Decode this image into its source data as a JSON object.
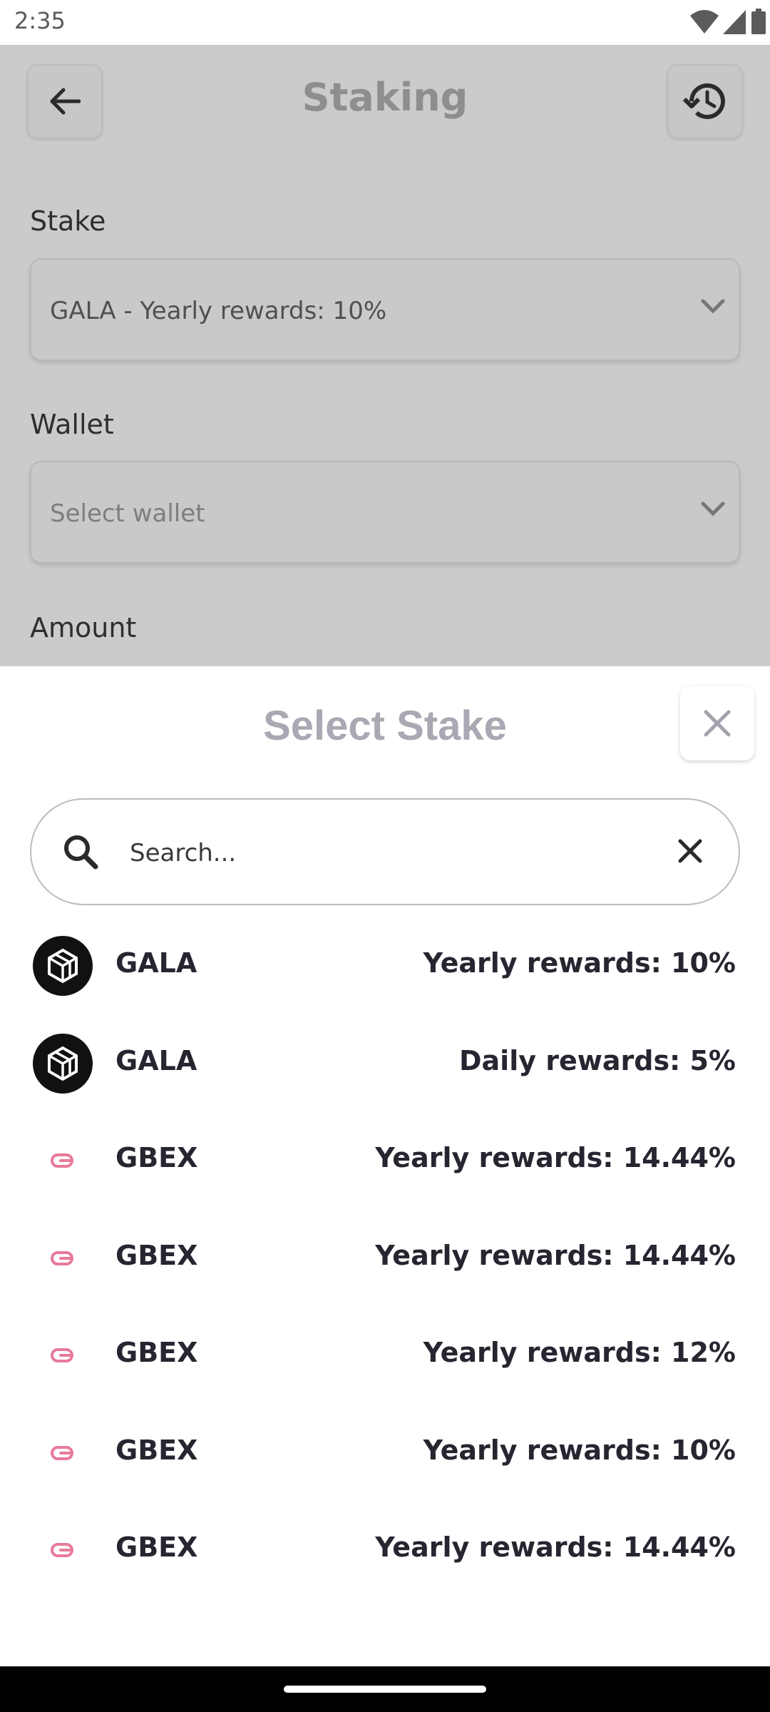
{
  "status_bar": {
    "time": "2:35"
  },
  "header": {
    "title": "Staking"
  },
  "form": {
    "stake_label": "Stake",
    "stake_value": "GALA - Yearly rewards: 10%",
    "wallet_label": "Wallet",
    "wallet_placeholder": "Select wallet",
    "amount_label": "Amount"
  },
  "sheet": {
    "title": "Select Stake",
    "search_placeholder": "Search...",
    "items": [
      {
        "name": "GALA",
        "reward": "Yearly rewards: 10%",
        "icon": "gala-logo-icon"
      },
      {
        "name": "GALA",
        "reward": "Daily rewards: 5%",
        "icon": "gala-logo-icon"
      },
      {
        "name": "GBEX",
        "reward": "Yearly rewards: 14.44%",
        "icon": "gbex-logo-icon"
      },
      {
        "name": "GBEX",
        "reward": "Yearly rewards: 14.44%",
        "icon": "gbex-logo-icon"
      },
      {
        "name": "GBEX",
        "reward": "Yearly rewards: 12%",
        "icon": "gbex-logo-icon"
      },
      {
        "name": "GBEX",
        "reward": "Yearly rewards: 10%",
        "icon": "gbex-logo-icon"
      },
      {
        "name": "GBEX",
        "reward": "Yearly rewards: 14.44%",
        "icon": "gbex-logo-icon"
      }
    ]
  },
  "colors": {
    "overlay": "#cbcbcb",
    "text_primary": "#262631",
    "sheet_title": "#a9a9b3",
    "gbex_accent": "#e87a9a"
  }
}
